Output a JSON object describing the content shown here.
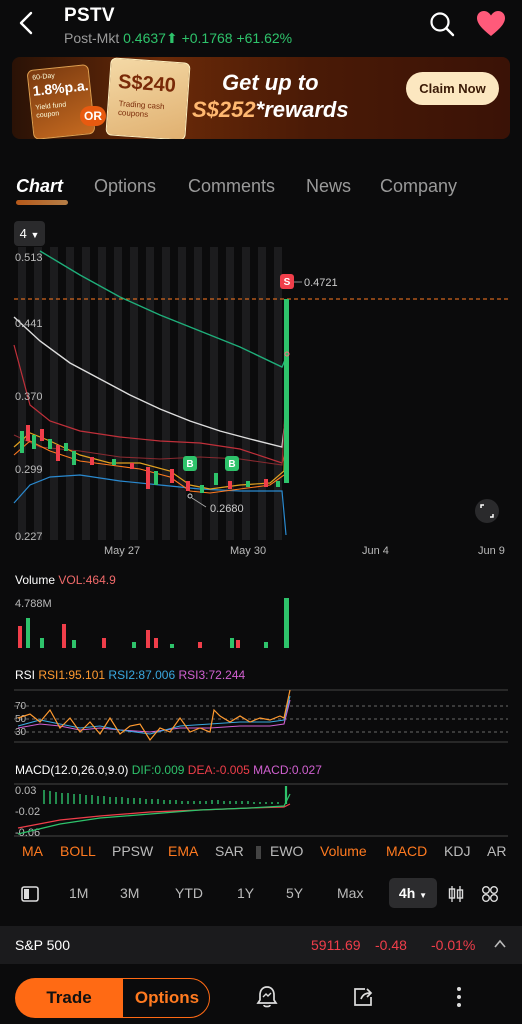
{
  "header": {
    "ticker": "PSTV",
    "session": "Post-Mkt",
    "price": "0.4637",
    "change": "+0.1768",
    "change_pct": "+61.62%"
  },
  "banner": {
    "coupon1_top": "60-Day",
    "coupon1_rate": "1.8%p.a.",
    "coupon1_desc": "Yield fund coupon",
    "coupon2_amount": "S$240",
    "coupon2_desc": "Trading cash coupons",
    "or_label": "OR",
    "title_line1": "Get up to",
    "title_amount": "S$252",
    "title_rest": "rewards",
    "claim_label": "Claim Now"
  },
  "tabs": [
    "Chart",
    "Options",
    "Comments",
    "News",
    "Company"
  ],
  "period_selector": "4",
  "price_chart": {
    "y_ticks": [
      "0.513",
      "0.441",
      "0.370",
      "0.299",
      "0.227"
    ],
    "x_ticks": [
      "May 27",
      "May 30",
      "Jun 4",
      "Jun 9"
    ],
    "last_label": "0.4721",
    "low_label": "0.2680",
    "sell_marker": "S",
    "buy_marker": "B"
  },
  "volume": {
    "title": "Volume",
    "value": "VOL:464.9",
    "max": "4.788M"
  },
  "rsi": {
    "title": "RSI",
    "rsi1": "RSI1:95.101",
    "rsi2": "RSI2:87.006",
    "rsi3": "RSI3:72.244",
    "levels": [
      "70",
      "50",
      "30"
    ]
  },
  "macd": {
    "title": "MACD(12.0,26.0,9.0)",
    "dif": "DIF:0.009",
    "dea": "DEA:-0.005",
    "macd": "MACD:0.027",
    "y_ticks": [
      "0.03",
      "-0.02",
      "-0.06"
    ]
  },
  "indicators": [
    "MA",
    "BOLL",
    "PPSW",
    "EMA",
    "SAR",
    "EWO",
    "Volume",
    "MACD",
    "KDJ",
    "AR"
  ],
  "timeframes": [
    "1M",
    "3M",
    "YTD",
    "1Y",
    "5Y",
    "Max"
  ],
  "timeframe_active": "4h",
  "index_bar": {
    "name": "S&P 500",
    "value": "5911.69",
    "change": "-0.48",
    "change_pct": "-0.01%"
  },
  "bottom_bar": {
    "trade_label": "Trade",
    "options_label": "Options"
  },
  "colors": {
    "up": "#2ec36b",
    "down": "#f03e4a",
    "accent": "#ff6a14",
    "bg": "#0b0b0c"
  }
}
